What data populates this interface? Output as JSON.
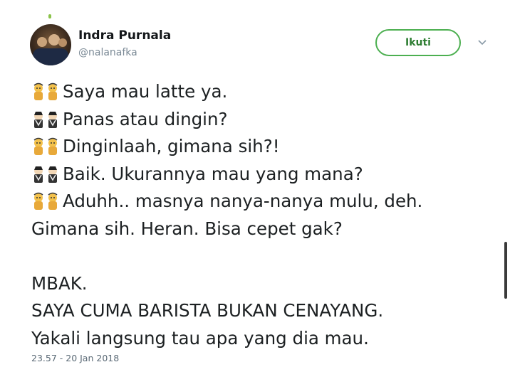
{
  "tweet": {
    "author_name": "Indra Purnala",
    "author_handle": "@nalanafka",
    "follow_label": "Ikuti",
    "lines": [
      {
        "icon": "woman-emoji-icon",
        "text": "Saya mau latte ya."
      },
      {
        "icon": "man-emoji-icon",
        "text": "Panas atau dingin?"
      },
      {
        "icon": "woman-emoji-icon",
        "text": "Dinginlaah, gimana sih?!"
      },
      {
        "icon": "man-emoji-icon",
        "text": "Baik. Ukurannya mau yang mana?"
      },
      {
        "icon": "woman-emoji-icon",
        "text": "Aduhh.. masnya nanya-nanya mulu, deh."
      },
      {
        "icon": "",
        "text": "Gimana sih. Heran. Bisa cepet gak?"
      },
      {
        "icon": "",
        "text": ""
      },
      {
        "icon": "",
        "text": "MBAK."
      },
      {
        "icon": "",
        "text": "SAYA CUMA BARISTA BUKAN CENAYANG."
      },
      {
        "icon": "",
        "text": "Yakali langsung tau apa yang dia mau."
      }
    ],
    "timestamp": "23.57 - 20 Jan 2018"
  },
  "colors": {
    "follow_border": "#4caf50",
    "follow_text": "#2e7d32",
    "text": "#1c2022",
    "muted": "#7b8a96"
  }
}
